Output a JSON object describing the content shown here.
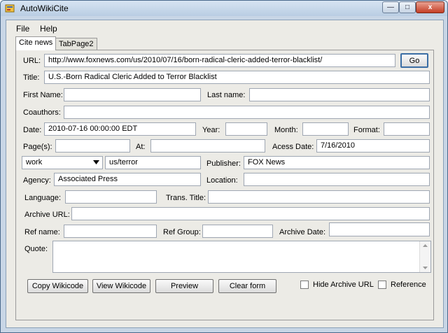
{
  "window": {
    "title": "AutoWikiCite",
    "minimize": "—",
    "maximize": "□",
    "close": "x"
  },
  "menu": {
    "file": "File",
    "help": "Help"
  },
  "tabs": {
    "cite_news": "Cite news",
    "tabpage2": "TabPage2"
  },
  "fields": {
    "url": {
      "label": "URL:",
      "value": "http://www.foxnews.com/us/2010/07/16/born-radical-cleric-added-terror-blacklist/"
    },
    "title": {
      "label": "Title:",
      "value": "U.S.-Born Radical Cleric Added to Terror Blacklist"
    },
    "first_name": {
      "label": "First Name:",
      "value": ""
    },
    "last_name": {
      "label": "Last name:",
      "value": ""
    },
    "coauthors": {
      "label": "Coauthors:",
      "value": ""
    },
    "date": {
      "label": "Date:",
      "value": "2010-07-16 00:00:00 EDT"
    },
    "year": {
      "label": "Year:",
      "value": ""
    },
    "month": {
      "label": "Month:",
      "value": ""
    },
    "format": {
      "label": "Format:",
      "value": ""
    },
    "pages": {
      "label": "Page(s):",
      "value": ""
    },
    "at": {
      "label": "At:",
      "value": ""
    },
    "access_date": {
      "label": "Acess Date:",
      "value": "7/16/2010"
    },
    "work_select": {
      "value": "work"
    },
    "work_value": {
      "value": "us/terror"
    },
    "publisher": {
      "label": "Publisher:",
      "value": "FOX News"
    },
    "agency": {
      "label": "Agency:",
      "value": "Associated Press"
    },
    "location": {
      "label": "Location:",
      "value": ""
    },
    "language": {
      "label": "Language:",
      "value": ""
    },
    "trans_title": {
      "label": "Trans. Title:",
      "value": ""
    },
    "archive_url": {
      "label": "Archive URL:",
      "value": ""
    },
    "ref_name": {
      "label": "Ref name:",
      "value": ""
    },
    "ref_group": {
      "label": "Ref Group:",
      "value": ""
    },
    "archive_date": {
      "label": "Archive Date:",
      "value": ""
    },
    "quote": {
      "label": "Quote:",
      "value": ""
    }
  },
  "buttons": {
    "go": "Go",
    "copy_wikicode": "Copy Wikicode",
    "view_wikicode": "View Wikicode",
    "preview": "Preview",
    "clear_form": "Clear form"
  },
  "checkboxes": {
    "hide_archive_url": {
      "label": "Hide Archive URL",
      "checked": false
    },
    "reference": {
      "label": "Reference",
      "checked": false
    }
  },
  "icons": {
    "app": "app-icon",
    "dropdown": "chevron-down-icon",
    "scroll_up": "scroll-up-icon",
    "scroll_down": "scroll-down-icon"
  }
}
